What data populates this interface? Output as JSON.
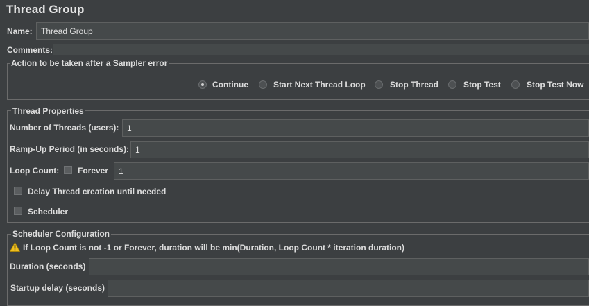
{
  "header": {
    "title": "Thread Group"
  },
  "name": {
    "label": "Name:",
    "value": "Thread Group"
  },
  "comments": {
    "label": "Comments:",
    "value": ""
  },
  "sampler_error": {
    "legend": "Action to be taken after a Sampler error",
    "selected": "Continue",
    "options": [
      "Continue",
      "Start Next Thread Loop",
      "Stop Thread",
      "Stop Test",
      "Stop Test Now"
    ]
  },
  "thread_properties": {
    "legend": "Thread Properties",
    "num_threads": {
      "label": "Number of Threads (users):",
      "value": "1"
    },
    "ramp_up": {
      "label": "Ramp-Up Period (in seconds):",
      "value": "1"
    },
    "loop_count": {
      "label": "Loop Count:",
      "forever_label": "Forever",
      "forever_checked": false,
      "value": "1"
    },
    "delay_creation": {
      "label": "Delay Thread creation until needed",
      "checked": false
    },
    "scheduler": {
      "label": "Scheduler",
      "checked": false
    }
  },
  "scheduler_config": {
    "legend": "Scheduler Configuration",
    "warning": "If Loop Count is not -1 or Forever, duration will be min(Duration, Loop Count * iteration duration)",
    "warning_icon": "warning-triangle-icon",
    "duration": {
      "label": "Duration (seconds)",
      "value": ""
    },
    "startup_delay": {
      "label": "Startup delay (seconds)",
      "value": ""
    }
  },
  "colors": {
    "background": "#3c3f41",
    "field": "#45494a",
    "warning": "#f0c020"
  }
}
